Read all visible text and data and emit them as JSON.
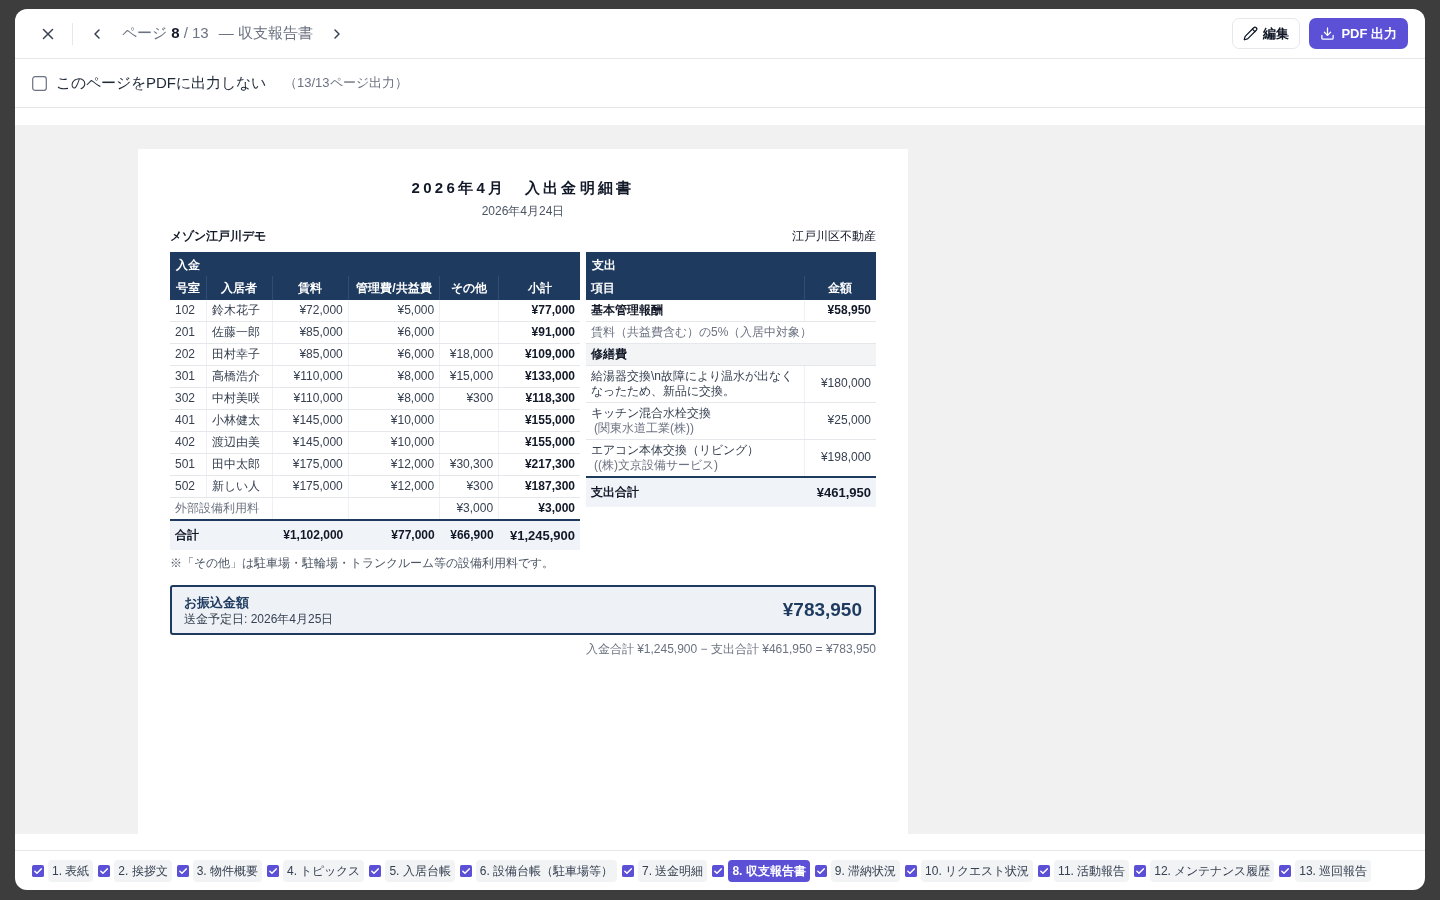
{
  "toolbar": {
    "page_indicator": "ページ **8** / 13",
    "page_title": "— 収支報告書",
    "edit_button": "編集",
    "export_button": "PDF 出力"
  },
  "exclude_option": {
    "label": "このページをPDFに出力しない",
    "checked": false,
    "count_note": "（13/13ページ出力）"
  },
  "document": {
    "title": "2026年4月　入出金明細書",
    "issue_date": "2026年4月24日",
    "property": "メゾン江戸川デモ",
    "company": "江戸川区不動産",
    "income": {
      "heading": "入金",
      "columns": [
        "号室",
        "入居者",
        "賃料",
        "管理費/共益費",
        "その他",
        "小計"
      ],
      "rows": [
        {
          "room": "102",
          "tenant": "鈴木花子",
          "rent": "¥72,000",
          "common_fee": "¥5,000",
          "subtotal": "¥77,000"
        },
        {
          "room": "201",
          "tenant": "佐藤一郎",
          "rent": "¥85,000",
          "common_fee": "¥6,000",
          "subtotal": "¥91,000"
        },
        {
          "room": "202",
          "tenant": "田村幸子",
          "rent": "¥85,000",
          "common_fee": "¥6,000",
          "other": "¥18,000",
          "subtotal": "¥109,000"
        },
        {
          "room": "301",
          "tenant": "高橋浩介",
          "rent": "¥110,000",
          "common_fee": "¥8,000",
          "other": "¥15,000",
          "subtotal": "¥133,000"
        },
        {
          "room": "302",
          "tenant": "中村美咲",
          "rent": "¥110,000",
          "common_fee": "¥8,000",
          "other": "¥300",
          "subtotal": "¥118,300"
        },
        {
          "room": "401",
          "tenant": "小林健太",
          "rent": "¥145,000",
          "common_fee": "¥10,000",
          "subtotal": "¥155,000"
        },
        {
          "room": "402",
          "tenant": "渡辺由美",
          "rent": "¥145,000",
          "common_fee": "¥10,000",
          "subtotal": "¥155,000"
        },
        {
          "room": "501",
          "tenant": "田中太郎",
          "rent": "¥175,000",
          "common_fee": "¥12,000",
          "other": "¥30,300",
          "subtotal": "¥217,300"
        },
        {
          "room": "502",
          "tenant": "新しい人",
          "rent": "¥175,000",
          "common_fee": "¥12,000",
          "other": "¥300",
          "subtotal": "¥187,300"
        }
      ],
      "extra_row": {
        "label": "外部設備利用料",
        "other": "¥3,000",
        "subtotal": "¥3,000"
      },
      "total": {
        "label": "合計",
        "rent": "¥1,102,000",
        "common_fee": "¥77,000",
        "other": "¥66,900",
        "subtotal": "¥1,245,900"
      },
      "note": "※「その他」は駐車場・駐輪場・トランクルーム等の設備利用料です。"
    },
    "expense": {
      "heading": "支出",
      "columns": [
        "項目",
        "金額"
      ],
      "rows": [
        {
          "kind": "fee",
          "name": "基本管理報酬",
          "amount": "¥58,950"
        },
        {
          "kind": "note",
          "text": "賃料（共益費含む）の5%（入居中対象）"
        },
        {
          "kind": "section",
          "text": "修繕費"
        },
        {
          "kind": "repair",
          "name": "給湯器交換\\n故障により温水が出なくなったため、新品に交換。",
          "amount": "¥180,000"
        },
        {
          "kind": "repair",
          "name": "キッチン混合水栓交換",
          "vendor": "(関東水道工業(株))",
          "amount": "¥25,000"
        },
        {
          "kind": "repair",
          "name": "エアコン本体交換（リビング）",
          "vendor": "((株)文京設備サービス)",
          "amount": "¥198,000"
        }
      ],
      "total": {
        "label": "支出合計",
        "amount": "¥461,950"
      }
    },
    "transfer": {
      "label": "お振込金額",
      "date": "送金予定日: 2026年4月25日",
      "amount": "¥783,950"
    },
    "formula": "入金合計 ¥1,245,900 − 支出合計 ¥461,950 = ¥783,950"
  },
  "pages": [
    {
      "label": "1. 表紙",
      "checked": true,
      "selected": false
    },
    {
      "label": "2. 挨拶文",
      "checked": true,
      "selected": false
    },
    {
      "label": "3. 物件概要",
      "checked": true,
      "selected": false
    },
    {
      "label": "4. トピックス",
      "checked": true,
      "selected": false
    },
    {
      "label": "5. 入居台帳",
      "checked": true,
      "selected": false
    },
    {
      "label": "6. 設備台帳（駐車場等）",
      "checked": true,
      "selected": false
    },
    {
      "label": "7. 送金明細",
      "checked": true,
      "selected": false
    },
    {
      "label": "8. 収支報告書",
      "checked": true,
      "selected": true
    },
    {
      "label": "9. 滞納状況",
      "checked": true,
      "selected": false
    },
    {
      "label": "10. リクエスト状況",
      "checked": true,
      "selected": false
    },
    {
      "label": "11. 活動報告",
      "checked": true,
      "selected": false
    },
    {
      "label": "12. メンテナンス履歴",
      "checked": true,
      "selected": false
    },
    {
      "label": "13. 巡回報告",
      "checked": true,
      "selected": false
    }
  ]
}
